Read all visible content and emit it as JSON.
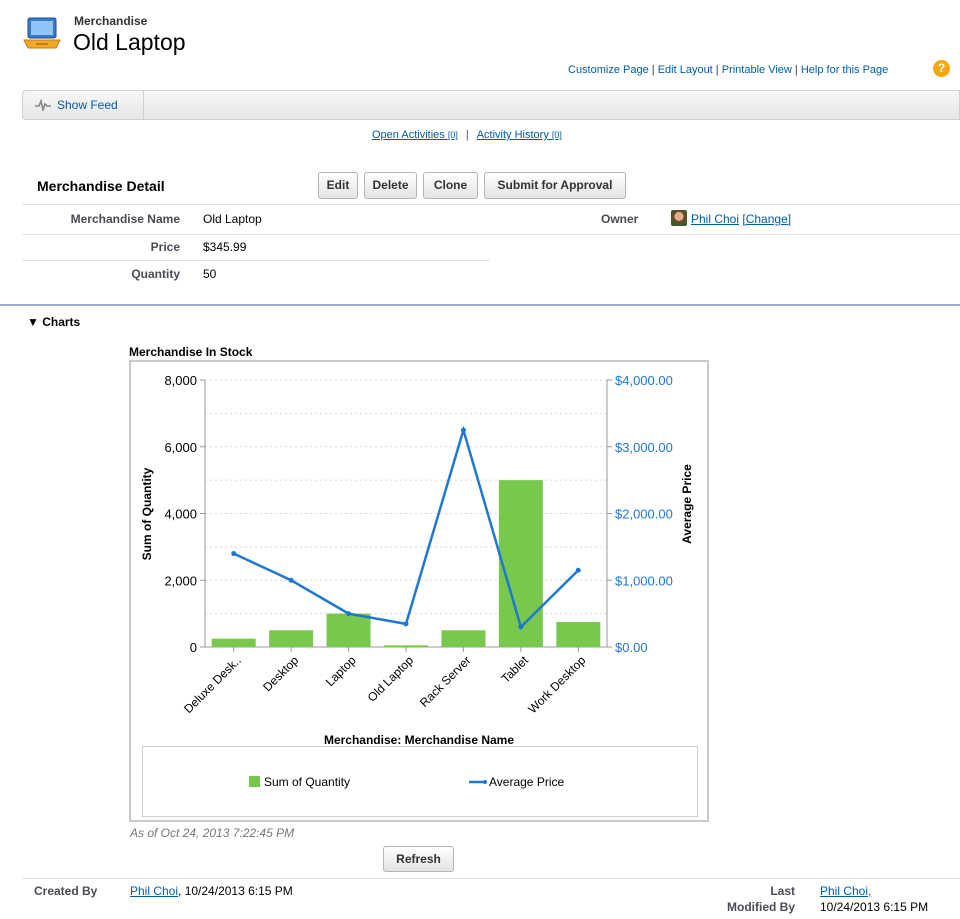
{
  "header": {
    "object_type": "Merchandise",
    "record_name": "Old Laptop",
    "links": [
      "Customize Page",
      "Edit Layout",
      "Printable View",
      "Help for this Page"
    ]
  },
  "feed": {
    "show_feed_label": "Show Feed"
  },
  "related": {
    "open_activities": "Open Activities",
    "open_activities_count": "[0]",
    "separator": "|",
    "activity_history": "Activity History",
    "activity_history_count": "[0]"
  },
  "detail": {
    "title": "Merchandise Detail",
    "buttons": [
      "Edit",
      "Delete",
      "Clone",
      "Submit for Approval"
    ],
    "fields": {
      "name_label": "Merchandise Name",
      "name_value": "Old Laptop",
      "price_label": "Price",
      "price_value": "$345.99",
      "quantity_label": "Quantity",
      "quantity_value": "50",
      "owner_label": "Owner",
      "owner_value": "Phil Choi",
      "owner_change": "[Change]"
    }
  },
  "charts_section": {
    "toggle_label": "▼ Charts",
    "as_of": "As of Oct 24, 2013 7:22:45 PM",
    "refresh_label": "Refresh"
  },
  "chart_data": {
    "type": "bar",
    "title": "Merchandise In Stock",
    "xlabel": "Merchandise: Merchandise Name",
    "ylabel": "Sum of Quantity",
    "y2label": "Average Price",
    "categories": [
      "Deluxe Desk..",
      "Desktop",
      "Laptop",
      "Old Laptop",
      "Rack Server",
      "Tablet",
      "Work Desktop"
    ],
    "series": [
      {
        "name": "Sum of Quantity",
        "type": "bar",
        "axis": "left",
        "values": [
          250,
          500,
          1000,
          50,
          500,
          5000,
          750
        ],
        "color": "#78c84d"
      },
      {
        "name": "Average Price",
        "type": "line",
        "axis": "right",
        "values": [
          1400,
          1000,
          500,
          345.99,
          3250,
          300,
          1150
        ],
        "color": "#1e78d2"
      }
    ],
    "ylim": [
      0,
      8000
    ],
    "y2lim": [
      0,
      4000
    ],
    "yticks": [
      "0",
      "2,000",
      "4,000",
      "6,000",
      "8,000"
    ],
    "y2ticks": [
      "$0.00",
      "$1,000.00",
      "$2,000.00",
      "$3,000.00",
      "$4,000.00"
    ],
    "grid": true,
    "legend": "bottom"
  },
  "footer": {
    "created_by_label": "Created By",
    "created_by_user": "Phil Choi",
    "created_by_date": ", 10/24/2013 6:15 PM",
    "last_modified_label_1": "Last",
    "last_modified_label_2": "Modified By",
    "last_modified_user": "Phil Choi,",
    "last_modified_date": "10/24/2013 6:15 PM"
  },
  "colors": {
    "link": "#015ba7",
    "divider": "#9ba9d6",
    "bar": "#78c84d",
    "line": "#1e78d2",
    "help": "#f0a80b"
  },
  "icons": [
    "merchandise-laptop-icon",
    "feed-pulse-icon",
    "help-icon",
    "owner-avatar"
  ]
}
